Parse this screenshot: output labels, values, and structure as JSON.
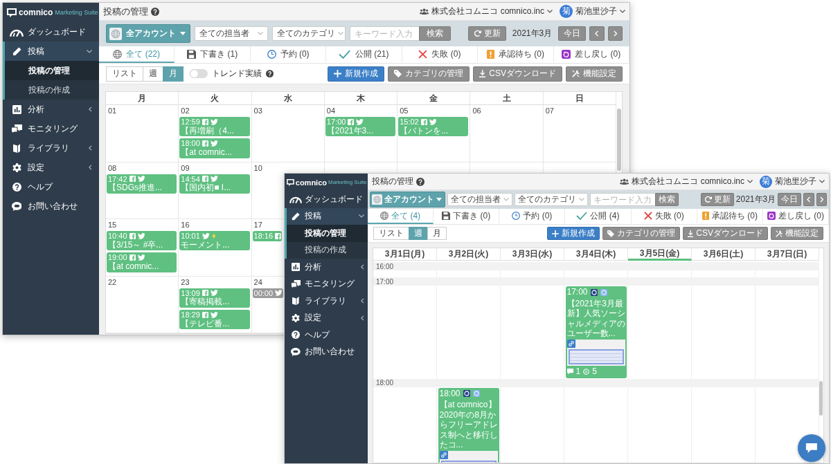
{
  "windows": [
    {
      "logo": {
        "name": "comnico",
        "tagline": "Marketing Suite"
      },
      "sidebar": {
        "items": [
          {
            "label": "ダッシュボード",
            "kind": "link",
            "expanded": false,
            "selected": false
          },
          {
            "label": "投稿",
            "kind": "group",
            "expanded": true,
            "selected": true,
            "children": [
              {
                "label": "投稿の管理",
                "selected": true
              },
              {
                "label": "投稿の作成",
                "selected": false
              }
            ]
          },
          {
            "label": "分析",
            "kind": "group",
            "expanded": false,
            "selected": false
          },
          {
            "label": "モニタリング",
            "kind": "link",
            "expanded": false,
            "selected": false
          },
          {
            "label": "ライブラリ",
            "kind": "group",
            "expanded": false,
            "selected": false
          },
          {
            "label": "設定",
            "kind": "group",
            "expanded": false,
            "selected": false
          },
          {
            "label": "ヘルプ",
            "kind": "link",
            "expanded": false,
            "selected": false
          },
          {
            "label": "お問い合わせ",
            "kind": "link",
            "expanded": false,
            "selected": false
          }
        ]
      },
      "header": {
        "title": "投稿の管理",
        "company": "株式会社コムニコ comnico.inc",
        "user": {
          "initial": "菊",
          "name": "菊池里沙子"
        }
      },
      "toolbar": {
        "account_button": "全アカウント",
        "filters": [
          {
            "value": "全ての担当者"
          },
          {
            "value": "全てのカテゴリ"
          }
        ],
        "keyword": {
          "placeholder": "キーワード入力"
        },
        "search_button": "検索",
        "refresh_button": "更新",
        "period": "2021年3月",
        "today_button": "今日"
      },
      "tabs": [
        {
          "label": "全て (22)",
          "selected": true
        },
        {
          "label": "下書き (1)",
          "selected": false
        },
        {
          "label": "予約 (0)",
          "selected": false
        },
        {
          "label": "公開 (21)",
          "selected": false
        },
        {
          "label": "失敗 (0)",
          "selected": false
        },
        {
          "label": "承認待ち (0)",
          "selected": false
        },
        {
          "label": "差し戻し (0)",
          "selected": false
        }
      ],
      "view_modes": [
        {
          "label": "リスト",
          "selected": false
        },
        {
          "label": "週",
          "selected": false
        },
        {
          "label": "月",
          "selected": true
        }
      ],
      "trend_toggle": {
        "label": "トレンド実績",
        "on": false
      },
      "actions": [
        {
          "label": "新規作成",
          "kind": "primary"
        },
        {
          "label": "カテゴリの管理",
          "kind": "secondary"
        },
        {
          "label": "CSVダウンロード",
          "kind": "secondary"
        },
        {
          "label": "機能設定",
          "kind": "secondary"
        }
      ],
      "calendar": {
        "kind": "month",
        "weekdays": [
          "月",
          "火",
          "水",
          "木",
          "金",
          "土",
          "日"
        ],
        "weeks": [
          {
            "days": [
              {
                "date": "01"
              },
              {
                "date": "02",
                "events": [
                  {
                    "time": "12:59",
                    "facebook": true,
                    "twitter": true,
                    "moment": false,
                    "title": "【再増刷（4...",
                    "draft": false
                  },
                  {
                    "time": "18:00",
                    "facebook": true,
                    "twitter": true,
                    "moment": false,
                    "title": "【at comnic...",
                    "draft": false
                  }
                ]
              },
              {
                "date": "03"
              },
              {
                "date": "04",
                "events": [
                  {
                    "time": "17:00",
                    "facebook": true,
                    "twitter": true,
                    "moment": false,
                    "title": "【2021年3...",
                    "draft": false
                  }
                ]
              },
              {
                "date": "05",
                "events": [
                  {
                    "time": "15:02",
                    "facebook": true,
                    "twitter": true,
                    "moment": false,
                    "title": "【バトンを...",
                    "draft": false
                  }
                ]
              },
              {
                "date": "06"
              },
              {
                "date": "07"
              }
            ]
          },
          {
            "days": [
              {
                "date": "08",
                "events": [
                  {
                    "time": "17:42",
                    "facebook": true,
                    "twitter": true,
                    "moment": false,
                    "title": "【SDGs推進...",
                    "draft": false
                  }
                ]
              },
              {
                "date": "09",
                "events": [
                  {
                    "time": "14:54",
                    "facebook": true,
                    "twitter": true,
                    "moment": false,
                    "title": "【国内初■ I...",
                    "draft": false
                  }
                ]
              },
              {
                "date": "10"
              }
            ]
          },
          {
            "days": [
              {
                "date": "15",
                "events": [
                  {
                    "time": "10:40",
                    "facebook": true,
                    "twitter": true,
                    "moment": false,
                    "title": "【3/15～ #卒...",
                    "draft": false
                  },
                  {
                    "time": "19:00",
                    "facebook": true,
                    "twitter": true,
                    "moment": false,
                    "title": "【at comnic...",
                    "draft": false
                  }
                ]
              },
              {
                "date": "16",
                "events": [
                  {
                    "time": "10:01",
                    "facebook": false,
                    "twitter": true,
                    "moment": true,
                    "title": "モーメント...",
                    "draft": false
                  }
                ]
              },
              {
                "date": "17",
                "events": [
                  {
                    "time": "18:16",
                    "facebook": true,
                    "twitter": false,
                    "moment": false,
                    "draft": false
                  }
                ]
              }
            ]
          },
          {
            "days": [
              {
                "date": "22"
              },
              {
                "date": "23",
                "events": [
                  {
                    "time": "13:09",
                    "facebook": true,
                    "twitter": true,
                    "moment": false,
                    "title": "【寄稿掲載...",
                    "draft": false
                  },
                  {
                    "time": "18:29",
                    "facebook": true,
                    "twitter": true,
                    "moment": false,
                    "title": "【テレビ番...",
                    "draft": false
                  }
                ]
              },
              {
                "date": "24",
                "events": [
                  {
                    "time": "00:00",
                    "facebook": false,
                    "twitter": true,
                    "moment": false,
                    "draft": true
                  }
                ]
              }
            ]
          }
        ]
      }
    },
    {
      "logo": {
        "name": "comnico",
        "tagline": "Marketing Suite"
      },
      "sidebar": {
        "items": [
          {
            "label": "ダッシュボード",
            "kind": "link",
            "expanded": false,
            "selected": false
          },
          {
            "label": "投稿",
            "kind": "group",
            "expanded": true,
            "selected": true,
            "children": [
              {
                "label": "投稿の管理",
                "selected": true
              },
              {
                "label": "投稿の作成",
                "selected": false
              }
            ]
          },
          {
            "label": "分析",
            "kind": "group",
            "expanded": false,
            "selected": false
          },
          {
            "label": "モニタリング",
            "kind": "link",
            "expanded": false,
            "selected": false
          },
          {
            "label": "ライブラリ",
            "kind": "group",
            "expanded": false,
            "selected": false
          },
          {
            "label": "設定",
            "kind": "group",
            "expanded": false,
            "selected": false
          },
          {
            "label": "ヘルプ",
            "kind": "link",
            "expanded": false,
            "selected": false
          },
          {
            "label": "お問い合わせ",
            "kind": "link",
            "expanded": false,
            "selected": false
          }
        ]
      },
      "header": {
        "title": "投稿の管理",
        "company": "株式会社コムニコ comnico.inc",
        "user": {
          "initial": "菊",
          "name": "菊池里沙子"
        }
      },
      "toolbar": {
        "account_button": "全アカウント",
        "filters": [
          {
            "value": "全ての担当者"
          },
          {
            "value": "全てのカテゴリ"
          }
        ],
        "keyword": {
          "placeholder": "キーワード入力"
        },
        "search_button": "検索",
        "refresh_button": "更新",
        "period": "2021年3月",
        "today_button": "今日"
      },
      "tabs": [
        {
          "label": "全て (4)",
          "selected": true
        },
        {
          "label": "下書き (0)",
          "selected": false
        },
        {
          "label": "予約 (0)",
          "selected": false
        },
        {
          "label": "公開 (4)",
          "selected": false
        },
        {
          "label": "失敗 (0)",
          "selected": false
        },
        {
          "label": "承認待ち (0)",
          "selected": false
        },
        {
          "label": "差し戻し (0)",
          "selected": false
        }
      ],
      "view_modes": [
        {
          "label": "リスト",
          "selected": false
        },
        {
          "label": "週",
          "selected": true
        },
        {
          "label": "月",
          "selected": false
        }
      ],
      "actions": [
        {
          "label": "新規作成",
          "kind": "primary"
        },
        {
          "label": "カテゴリの管理",
          "kind": "secondary"
        },
        {
          "label": "CSVダウンロード",
          "kind": "secondary"
        },
        {
          "label": "機能設定",
          "kind": "secondary"
        }
      ],
      "calendar": {
        "kind": "week",
        "days": [
          {
            "label": "3月1日(月)",
            "today": false
          },
          {
            "label": "3月2日(火)",
            "today": false
          },
          {
            "label": "3月3日(水)",
            "today": false
          },
          {
            "label": "3月4日(木)",
            "today": false
          },
          {
            "label": "3月5日(金)",
            "today": true
          },
          {
            "label": "3月6日(土)",
            "today": false
          },
          {
            "label": "3月7日(日)",
            "today": false
          }
        ],
        "slots": [
          {
            "time": "16:00"
          },
          {
            "time": "17:00",
            "cells": [
              null,
              null,
              null,
              {
                "time": "17:00",
                "facebook": true,
                "twitter": true,
                "text": "【2021年3月最新】人気ソーシャルメディアのユーザー数...",
                "draft": false,
                "comments": "1",
                "engagements": "5"
              },
              null,
              null,
              null
            ]
          },
          {
            "time": "18:00",
            "cells": [
              null,
              {
                "time": "18:00",
                "facebook": true,
                "twitter": true,
                "text": "【at comnico】\n2020年の8月からフリーアドレス制へと移行したコ...",
                "draft": false
              },
              null,
              null,
              null,
              null,
              null
            ]
          }
        ]
      }
    }
  ]
}
